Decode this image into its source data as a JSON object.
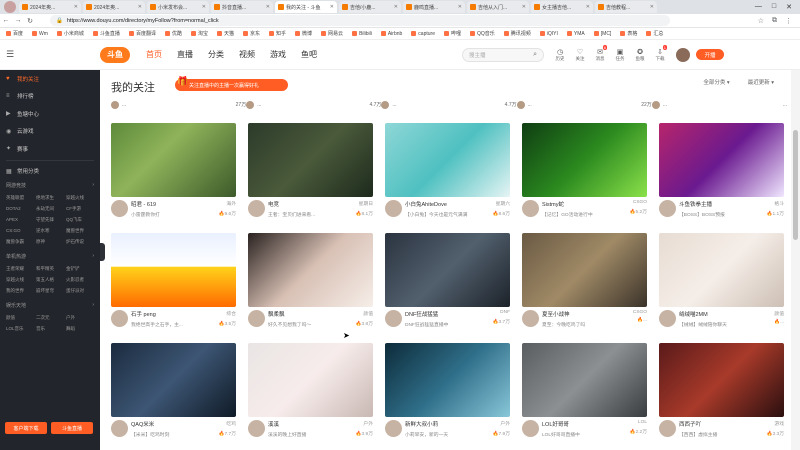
{
  "browser": {
    "tabs": [
      {
        "label": "2024年奥..."
      },
      {
        "label": "2024年奥..."
      },
      {
        "label": "小米发布会..."
      },
      {
        "label": "抖音直播..."
      },
      {
        "label": "我的关注 - 斗鱼",
        "active": true
      },
      {
        "label": "吉他/小鹿..."
      },
      {
        "label": "鹿鸣直播..."
      },
      {
        "label": "吉他从入门..."
      },
      {
        "label": "女主播吉他..."
      },
      {
        "label": "吉他教程..."
      }
    ],
    "url": "https://www.douyu.com/directory/myFollow?from=normal_click",
    "bookmarks": [
      "百度",
      "Wm",
      "小米商城",
      "斗鱼直播",
      "百度翻译",
      "优酷",
      "淘宝",
      "天猫",
      "京东",
      "知乎",
      "微博",
      "网易云",
      "Bilibili",
      "Airbnb",
      "capture",
      "哔哩",
      "QQ音乐",
      "腾讯视频",
      "iQIYI",
      "YMA",
      "[MC]",
      "表格",
      "汇总"
    ]
  },
  "header": {
    "logo": "斗鱼",
    "nav": [
      "首页",
      "直播",
      "分类",
      "视频",
      "游戏",
      "鱼吧"
    ],
    "search_placeholder": "搜主播",
    "tools": [
      {
        "icon": "history-icon",
        "label": "历史"
      },
      {
        "icon": "heart-icon",
        "label": "关注"
      },
      {
        "icon": "bell-icon",
        "label": "消息",
        "badge": "6"
      },
      {
        "icon": "gift-icon",
        "label": "任务"
      },
      {
        "icon": "star-icon",
        "label": "鱼粮"
      },
      {
        "icon": "download-icon",
        "label": "下载",
        "badge": "1"
      }
    ],
    "live_button": "开播"
  },
  "sidebar": {
    "items": [
      {
        "icon": "heart-icon",
        "label": "我的关注",
        "active": true
      },
      {
        "icon": "list-icon",
        "label": "排行榜"
      },
      {
        "icon": "video-icon",
        "label": "鱼塘中心"
      },
      {
        "icon": "play-icon",
        "label": "云游戏"
      },
      {
        "icon": "game-icon",
        "label": "赛事"
      }
    ],
    "section_title": "常用分类",
    "categories": [
      {
        "title": "网游竞技",
        "items": [
          "英雄联盟",
          "绝地求生",
          "穿越火线",
          "DOTA2",
          "永劫无间",
          "CF手游",
          "APEX",
          "守望先锋",
          "QQ飞车",
          "CS:GO",
          "逆水寒",
          "魔兽世界",
          "魔兽争霸",
          "原神",
          "炉石传说"
        ]
      },
      {
        "title": "单机热游",
        "items": [
          "王者荣耀",
          "和平精英",
          "金铲铲",
          "穿越火线",
          "第五人格",
          "火影忍者",
          "我的世界",
          "崩坏星穹",
          "蛋仔派对"
        ]
      },
      {
        "title": "娱乐天地",
        "items": [
          "颜值",
          "二次元",
          "户外",
          "LOL音乐",
          "音乐",
          "舞蹈"
        ]
      }
    ],
    "footer": [
      "客户端下载",
      "斗鱼直播"
    ]
  },
  "main": {
    "title": "我的关注",
    "banner": "关注直播中的主播一次赢得好礼",
    "filters": [
      "全部分类",
      "最近更新"
    ],
    "partial_row": [
      {
        "name": "...",
        "views": "27万"
      },
      {
        "name": "...",
        "views": "4.7万"
      },
      {
        "name": "...",
        "views": "4.7万"
      },
      {
        "name": "...",
        "views": "22万"
      },
      {
        "name": "...",
        "views": "..."
      }
    ],
    "cards": [
      {
        "name": "昭君 - 619",
        "title": "小雷霆教你打",
        "right": "海外",
        "views": "9.6万",
        "thumb": "thumb-game-green"
      },
      {
        "name": "电竞",
        "title": "王者：宝贝们进来看...",
        "right": "星期日",
        "views": "8.1万",
        "thumb": "thumb-game-dark"
      },
      {
        "name": "小白兔AhiteDove",
        "title": "【小白兔】今天也是元气满满",
        "right": "星期六",
        "views": "8.6万",
        "thumb": "thumb-game-teal"
      },
      {
        "name": "Sistmy蛇",
        "title": "【记忆】GO活动进行中",
        "right": "CSGO",
        "views": "5.2万",
        "thumb": "thumb-green-poster"
      },
      {
        "name": "斗鱼铁拳主播",
        "title": "【BOSS】BOSS预报",
        "right": "格斗",
        "views": "1.1万",
        "thumb": "thumb-team-poster"
      },
      {
        "name": "石手 peng",
        "title": "我绝世高手之石手，主...",
        "right": "综合",
        "views": "3.5万",
        "thumb": "thumb-stream-banner"
      },
      {
        "name": "飘柔飘",
        "title": "好久不见想我了吗～",
        "right": "颜值",
        "views": "3.8万",
        "thumb": "thumb-girl-1"
      },
      {
        "name": "DNF狂战猛猛",
        "title": "DNF狂战猛猛直播中",
        "right": "DNF",
        "views": "3.7万",
        "thumb": "thumb-game-night"
      },
      {
        "name": "夏至小战神",
        "title": "夏至：今晚吃鸡了吗",
        "right": "CSGO",
        "views": "...",
        "thumb": "thumb-fps"
      },
      {
        "name": "绒绒喵2MM",
        "title": "【绒绒】绒绒陪你聊天",
        "right": "颜值",
        "views": "...",
        "thumb": "thumb-girl-2"
      },
      {
        "name": "QAQ米米",
        "title": "【米米】吃鸡时刻",
        "right": "吃鸡",
        "views": "7.7万",
        "thumb": "thumb-hero"
      },
      {
        "name": "溪溪",
        "title": "溪溪的晚上好直播",
        "right": "户外",
        "views": "3.9万",
        "thumb": "thumb-girl-3"
      },
      {
        "name": "新鲜大叔小莉",
        "title": "小莉早安，新的一天",
        "right": "户外",
        "views": "7.9万",
        "thumb": "thumb-flower"
      },
      {
        "name": "LOL好哥哥",
        "title": "LOL好哥哥直播中",
        "right": "LOL",
        "views": "2.2万",
        "thumb": "thumb-office"
      },
      {
        "name": "西西子吖",
        "title": "【西西】虚拟主播",
        "right": "游戏",
        "views": "3.3万",
        "thumb": "thumb-moba"
      }
    ]
  },
  "colors": {
    "accent": "#ff5d23",
    "sidebar_bg": "#22252b"
  }
}
